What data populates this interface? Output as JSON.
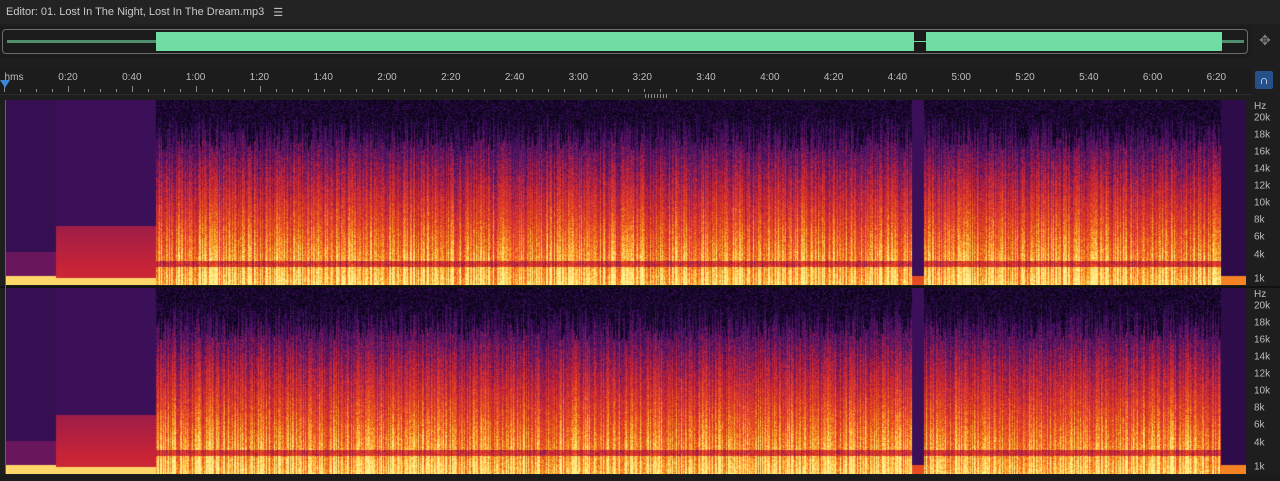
{
  "editor": {
    "title": "Editor: 01. Lost In The Night, Lost In The Dream.mp3",
    "menu_icon": "hamburger-menu-icon"
  },
  "overview": {
    "zoom_icon": "zoom-navigator-icon"
  },
  "ruler": {
    "unit": "hms",
    "labels": [
      "0:20",
      "0:40",
      "1:00",
      "1:20",
      "1:40",
      "2:00",
      "2:20",
      "2:40",
      "3:00",
      "3:20",
      "3:40",
      "4:00",
      "4:20",
      "4:40",
      "5:00",
      "5:20",
      "5:40",
      "6:00",
      "6:20"
    ],
    "snap_icon": "magnet-snap-icon"
  },
  "spectral_axis": {
    "unit": "Hz",
    "labels": [
      "20k",
      "18k",
      "16k",
      "14k",
      "12k",
      "10k",
      "8k",
      "6k",
      "4k",
      "1k"
    ]
  },
  "colors": {
    "waveform": "#6fdca4",
    "accent": "#25508a",
    "playhead": "#3b86d6",
    "spectral_low": "#2a0f4a",
    "spectral_mid": "#d8322a",
    "spectral_high": "#ffe27a"
  }
}
